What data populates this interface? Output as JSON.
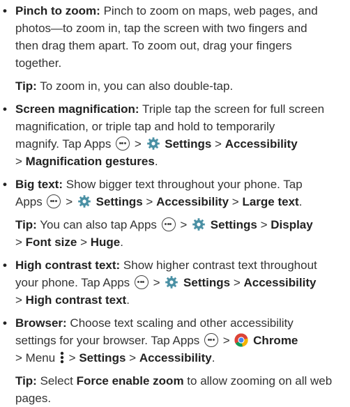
{
  "pinch": {
    "title": "Pinch to zoom:",
    "l1": "Pinch to zoom on maps, web pages, and",
    "l2": "photos—to zoom in, tap the screen with two fingers and",
    "l3": "then drag them apart. To zoom out, drag your fingers",
    "l4": "together.",
    "tip_label": "Tip:",
    "tip_text": "To zoom in, you can also double-tap."
  },
  "magnification": {
    "title": "Screen magnification:",
    "l1": "Triple tap the screen for full screen",
    "l2": "magnification, or triple tap and hold to temporarily",
    "l3a": "magnify. Tap Apps",
    "settings": "Settings",
    "accessibility": "Accessibility",
    "gestures": "Magnification gestures"
  },
  "bigtext": {
    "title": "Big text:",
    "l1": "Show bigger text throughout your phone. Tap",
    "apps": "Apps",
    "settings": "Settings",
    "accessibility": "Accessibility",
    "large_text": "Large text",
    "tip_label": "Tip:",
    "tip_text": "You can also tap Apps",
    "display": "Display",
    "font_size": "Font size",
    "huge": "Huge"
  },
  "contrast": {
    "title": "High contrast text:",
    "l1": "Show higher contrast text throughout",
    "l2a": "your phone. Tap Apps",
    "settings": "Settings",
    "accessibility": "Accessibility",
    "hct": "High contrast text"
  },
  "browser": {
    "title": "Browser:",
    "l1": "Choose text scaling and other accessibility",
    "l2a": "settings for your browser. Tap Apps",
    "chrome": "Chrome",
    "menu": "Menu",
    "settings": "Settings",
    "accessibility": "Accessibility",
    "tip_label": "Tip:",
    "tip_a": "Select",
    "force": "Force enable zoom",
    "tip_b": "to allow zooming on all web",
    "tip_c": "pages."
  },
  "sep": ">",
  "bullet": "•",
  "colors": {
    "text": "#333333",
    "bold": "#222222",
    "gear": "#4a90a4"
  }
}
